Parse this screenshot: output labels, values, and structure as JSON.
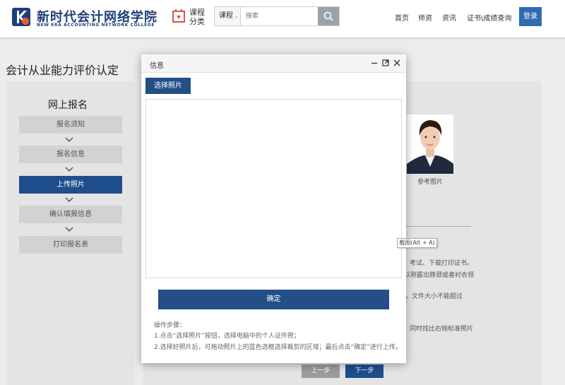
{
  "header": {
    "logo_title": "新时代会计网络学院",
    "logo_subtitle": "NEW ERA ACCOUNTING NETWORK COLLEGE",
    "category_label": "课程分类",
    "search_select": "课程",
    "search_placeholder": "搜索",
    "nav": [
      "首页",
      "师资",
      "资讯",
      "证书\\成绩查询"
    ],
    "login_label": "登录"
  },
  "page": {
    "title": "会计从业能力评价认定"
  },
  "sidebar": {
    "heading": "网上报名",
    "steps": [
      {
        "label": "报名须知",
        "active": false
      },
      {
        "label": "报名信息",
        "active": false
      },
      {
        "label": "上传照片",
        "active": true
      },
      {
        "label": "确认填报信息",
        "active": false
      },
      {
        "label": "打印报名表",
        "active": false
      }
    ]
  },
  "main": {
    "ref_photo_label": "参考图片",
    "tip_fragments": [
      "考试、下载打印证书。",
      "以刚露出脖颈或者衬衣领",
      "，文件大小不能超过",
      "同时找比右侧标准照片"
    ],
    "prev_label": "上一步",
    "next_label": "下一步"
  },
  "tooltip": "截图(Alt + A)",
  "modal": {
    "title": "信息",
    "choose_label": "选择照片",
    "confirm_label": "确定",
    "steps_title": "操作步骤：",
    "step1": "1.点击“选择照片”按钮，选择电脑中的个人证件照；",
    "step2": "2.选择好照片后，可拖动照片上的蓝色选框选择裁剪的区域；最后点击“确定”进行上传。"
  },
  "colors": {
    "brand_navy": "#1f3f7a",
    "active_step": "#1e4e8c",
    "login_blue": "#2f6bb3",
    "logo_orange": "#e8622a"
  },
  "icons": [
    "logo-icon",
    "category-icon",
    "search-icon",
    "chevron-down-icon",
    "minimize-icon",
    "maximize-icon",
    "close-icon"
  ]
}
